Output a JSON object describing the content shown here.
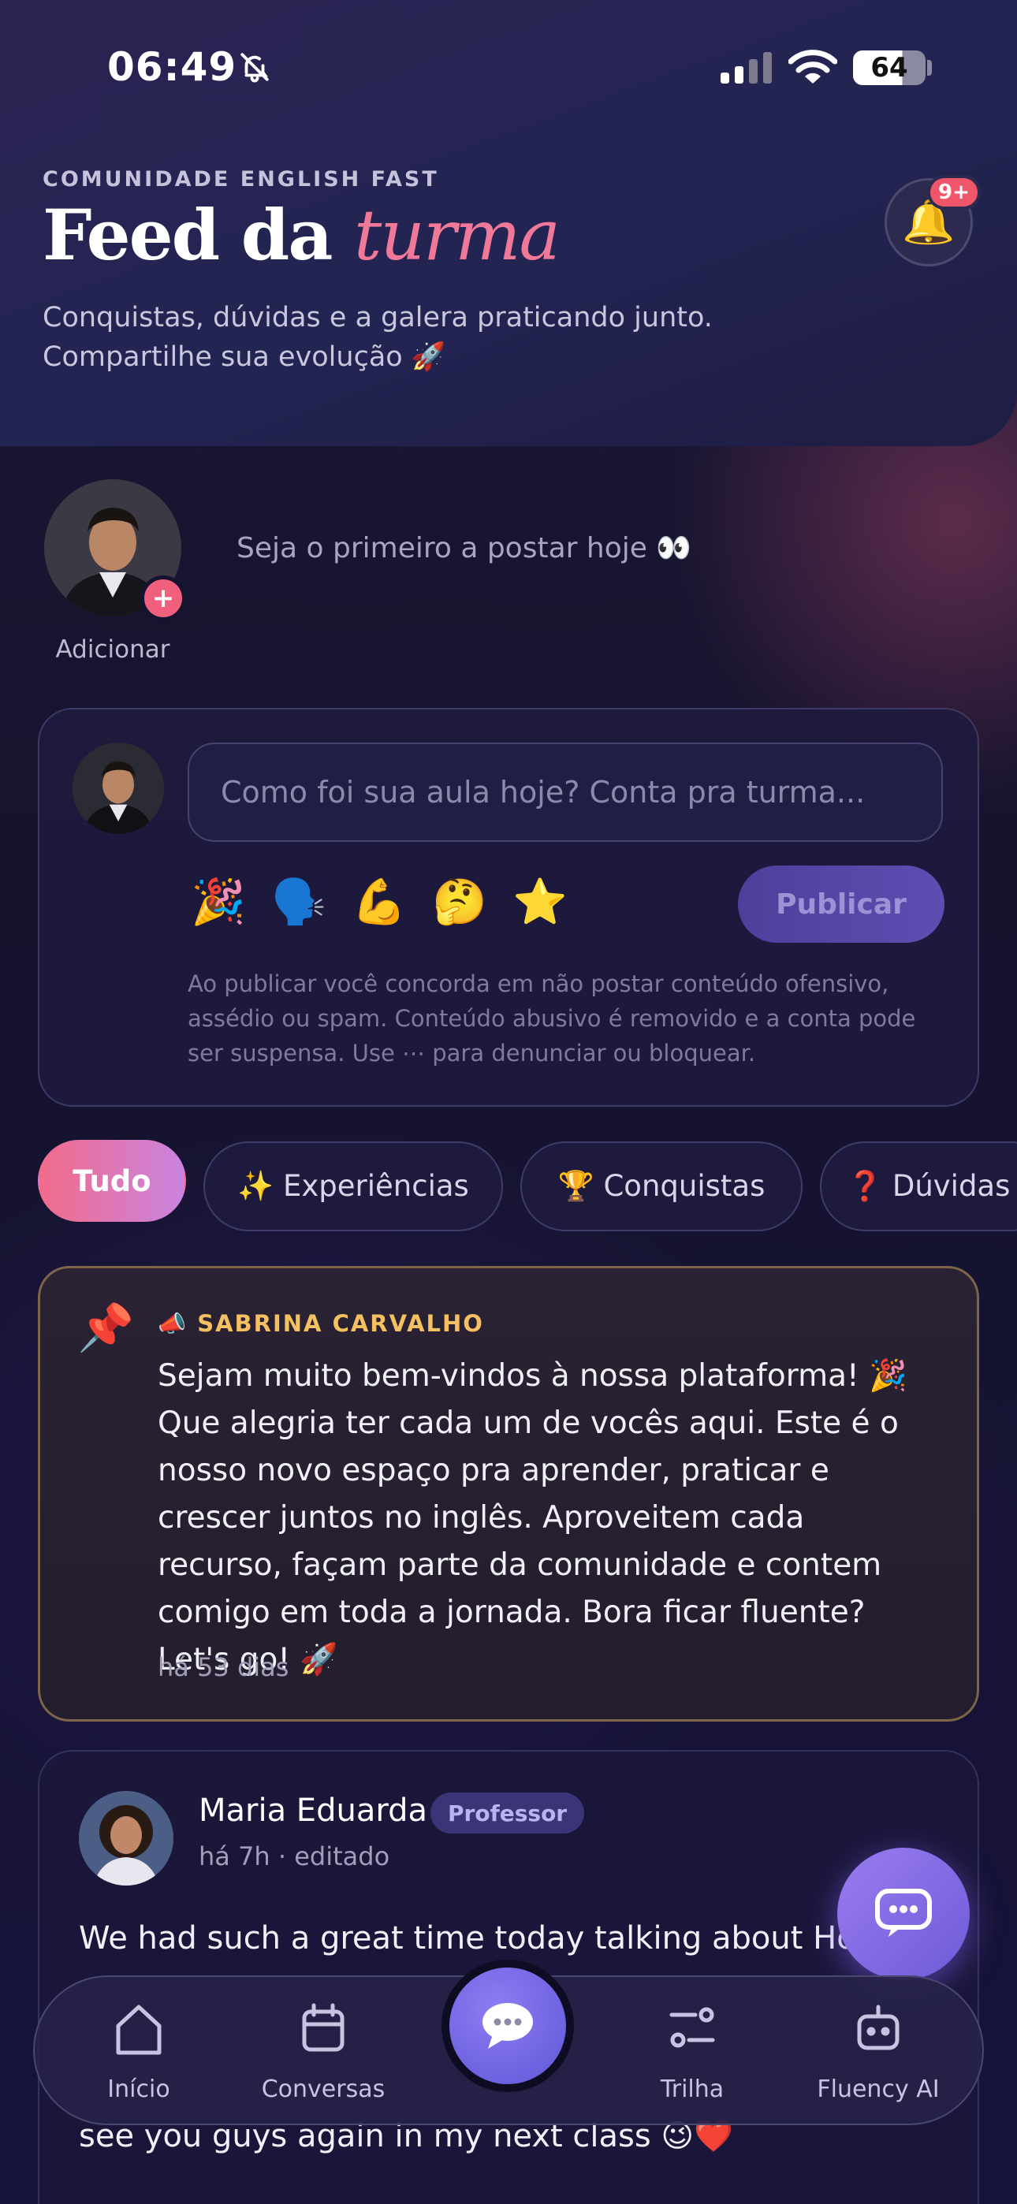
{
  "status_bar": {
    "time": "06:49",
    "battery": "64"
  },
  "header": {
    "eyebrow": "COMUNIDADE ENGLISH FAST",
    "title_main": "Feed da ",
    "title_accent": "turma",
    "subtitle_line1": "Conquistas, dúvidas e a galera praticando junto.",
    "subtitle_line2": "Compartilhe sua evolução 🚀",
    "notification_badge": "9+"
  },
  "stories": {
    "add_label": "Adicionar",
    "add_symbol": "+",
    "empty_text": "Seja o primeiro a postar hoje 👀"
  },
  "composer": {
    "placeholder": "Como foi sua aula hoje? Conta pra turma...",
    "emojis": [
      "🎉",
      "🗣️",
      "💪",
      "🤔",
      "⭐"
    ],
    "publish_label": "Publicar",
    "disclaimer": "Ao publicar você concorda em não postar conteúdo ofensivo, assédio ou spam. Conteúdo abusivo é removido e a conta pode ser suspensa. Use ⋯ para denunciar ou bloquear."
  },
  "filters": [
    {
      "label": "Tudo",
      "active": true
    },
    {
      "label": "✨ Experiências"
    },
    {
      "label": "🏆 Conquistas"
    },
    {
      "label": "❓ Dúvidas"
    }
  ],
  "pinned_post": {
    "author": "📣 SABRINA CARVALHO",
    "body": "Sejam muito bem-vindos à nossa plataforma! 🎉 Que alegria ter cada um de vocês aqui. Este é o nosso novo espaço pra aprender, praticar e crescer juntos no inglês. Aproveitem cada recurso, façam parte da comunidade e contem comigo em toda a jornada. Bora ficar fluente? Let's go! 🚀",
    "time": "há 53 dias"
  },
  "post": {
    "author": "Maria Eduarda",
    "role": "Professor",
    "meta": "há 7h · editado",
    "line1": "We had such a great time today talking about House",
    "line2": "see you guys again in my next class 😉❤️"
  },
  "tabbar": {
    "items": [
      {
        "label": "Início",
        "icon": "home-icon"
      },
      {
        "label": "Conversas",
        "icon": "calendar-icon"
      },
      {
        "label": "Trilha",
        "icon": "path-icon"
      },
      {
        "label": "Fluency AI",
        "icon": "robot-icon"
      }
    ]
  },
  "colors": {
    "accent_pink": "#f07898",
    "gold": "#f4c060",
    "purple": "#6f5ad8"
  }
}
